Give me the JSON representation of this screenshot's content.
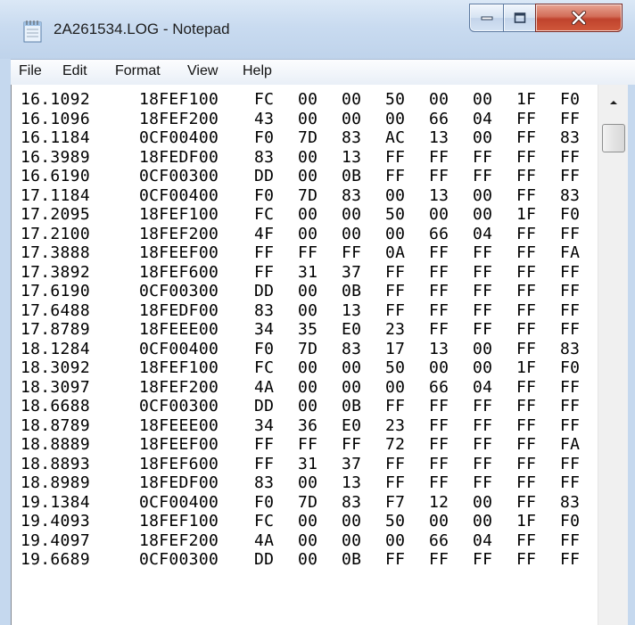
{
  "window": {
    "title": "2A261534.LOG - Notepad"
  },
  "menu": [
    "File",
    "Edit",
    "Format",
    "View",
    "Help"
  ],
  "log_lines": [
    [
      "16.1092",
      "18FEF100",
      "FC",
      "00",
      "00",
      "50",
      "00",
      "00",
      "1F",
      "F0"
    ],
    [
      "16.1096",
      "18FEF200",
      "43",
      "00",
      "00",
      "00",
      "66",
      "04",
      "FF",
      "FF"
    ],
    [
      "16.1184",
      "0CF00400",
      "F0",
      "7D",
      "83",
      "AC",
      "13",
      "00",
      "FF",
      "83"
    ],
    [
      "16.3989",
      "18FEDF00",
      "83",
      "00",
      "13",
      "FF",
      "FF",
      "FF",
      "FF",
      "FF"
    ],
    [
      "16.6190",
      "0CF00300",
      "DD",
      "00",
      "0B",
      "FF",
      "FF",
      "FF",
      "FF",
      "FF"
    ],
    [
      "17.1184",
      "0CF00400",
      "F0",
      "7D",
      "83",
      "00",
      "13",
      "00",
      "FF",
      "83"
    ],
    [
      "17.2095",
      "18FEF100",
      "FC",
      "00",
      "00",
      "50",
      "00",
      "00",
      "1F",
      "F0"
    ],
    [
      "17.2100",
      "18FEF200",
      "4F",
      "00",
      "00",
      "00",
      "66",
      "04",
      "FF",
      "FF"
    ],
    [
      "17.3888",
      "18FEEF00",
      "FF",
      "FF",
      "FF",
      "0A",
      "FF",
      "FF",
      "FF",
      "FA"
    ],
    [
      "17.3892",
      "18FEF600",
      "FF",
      "31",
      "37",
      "FF",
      "FF",
      "FF",
      "FF",
      "FF"
    ],
    [
      "17.6190",
      "0CF00300",
      "DD",
      "00",
      "0B",
      "FF",
      "FF",
      "FF",
      "FF",
      "FF"
    ],
    [
      "17.6488",
      "18FEDF00",
      "83",
      "00",
      "13",
      "FF",
      "FF",
      "FF",
      "FF",
      "FF"
    ],
    [
      "17.8789",
      "18FEEE00",
      "34",
      "35",
      "E0",
      "23",
      "FF",
      "FF",
      "FF",
      "FF"
    ],
    [
      "18.1284",
      "0CF00400",
      "F0",
      "7D",
      "83",
      "17",
      "13",
      "00",
      "FF",
      "83"
    ],
    [
      "18.3092",
      "18FEF100",
      "FC",
      "00",
      "00",
      "50",
      "00",
      "00",
      "1F",
      "F0"
    ],
    [
      "18.3097",
      "18FEF200",
      "4A",
      "00",
      "00",
      "00",
      "66",
      "04",
      "FF",
      "FF"
    ],
    [
      "18.6688",
      "0CF00300",
      "DD",
      "00",
      "0B",
      "FF",
      "FF",
      "FF",
      "FF",
      "FF"
    ],
    [
      "18.8789",
      "18FEEE00",
      "34",
      "36",
      "E0",
      "23",
      "FF",
      "FF",
      "FF",
      "FF"
    ],
    [
      "18.8889",
      "18FEEF00",
      "FF",
      "FF",
      "FF",
      "72",
      "FF",
      "FF",
      "FF",
      "FA"
    ],
    [
      "18.8893",
      "18FEF600",
      "FF",
      "31",
      "37",
      "FF",
      "FF",
      "FF",
      "FF",
      "FF"
    ],
    [
      "18.8989",
      "18FEDF00",
      "83",
      "00",
      "13",
      "FF",
      "FF",
      "FF",
      "FF",
      "FF"
    ],
    [
      "19.1384",
      "0CF00400",
      "F0",
      "7D",
      "83",
      "F7",
      "12",
      "00",
      "FF",
      "83"
    ],
    [
      "19.4093",
      "18FEF100",
      "FC",
      "00",
      "00",
      "50",
      "00",
      "00",
      "1F",
      "F0"
    ],
    [
      "19.4097",
      "18FEF200",
      "4A",
      "00",
      "00",
      "00",
      "66",
      "04",
      "FF",
      "FF"
    ],
    [
      "19.6689",
      "0CF00300",
      "DD",
      "00",
      "0B",
      "FF",
      "FF",
      "FF",
      "FF",
      "FF"
    ]
  ],
  "icons": {
    "app": "notepad-icon",
    "minimize": "minimize-icon",
    "maximize": "maximize-icon",
    "close": "close-icon",
    "scroll_up": "scroll-up-arrow-icon"
  },
  "colors": {
    "titlebar": "#c9dbf0",
    "close_button": "#c0432d",
    "text": "#000000",
    "background": "#ffffff"
  }
}
